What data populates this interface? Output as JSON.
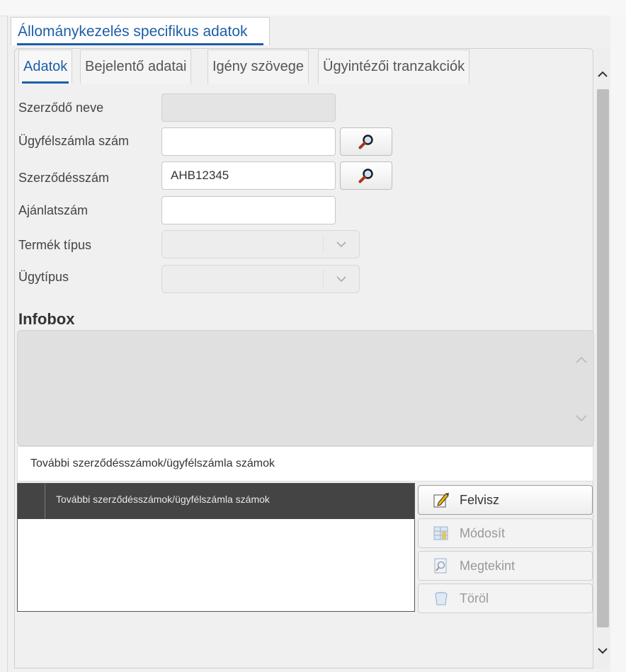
{
  "outer_tab": {
    "label": "Állománykezelés specifikus adatok"
  },
  "tabs": [
    {
      "label": "Adatok"
    },
    {
      "label": "Bejelentő adatai"
    },
    {
      "label": "Igény szövege"
    },
    {
      "label": "Ügyintézői tranzakciók"
    }
  ],
  "form": {
    "contract_name": {
      "label": "Szerződő neve",
      "value": ""
    },
    "client_account": {
      "label": "Ügyfélszámla szám",
      "value": ""
    },
    "contract_number": {
      "label": "Szerződésszám",
      "value": "AHB12345"
    },
    "offer_number": {
      "label": "Ajánlatszám",
      "value": ""
    },
    "product_type": {
      "label": "Termék típus",
      "value": ""
    },
    "case_type": {
      "label": "Ügytípus",
      "value": ""
    }
  },
  "infobox": {
    "title": "Infobox",
    "text": ""
  },
  "more_numbers": {
    "title": "További szerződésszámok/ügyfélszámla számok",
    "grid_columns": [
      "További szerződésszámok/ügyfélszámla számok"
    ],
    "rows": []
  },
  "actions": [
    {
      "label": "Felvisz",
      "enabled": true,
      "icon": "pencil-icon"
    },
    {
      "label": "Módosít",
      "enabled": false,
      "icon": "edit-grid-icon"
    },
    {
      "label": "Megtekint",
      "enabled": false,
      "icon": "view-document-icon"
    },
    {
      "label": "Töröl",
      "enabled": false,
      "icon": "trash-icon"
    }
  ],
  "colors": {
    "accent": "#1e5ea8",
    "grid_header": "#444444"
  }
}
